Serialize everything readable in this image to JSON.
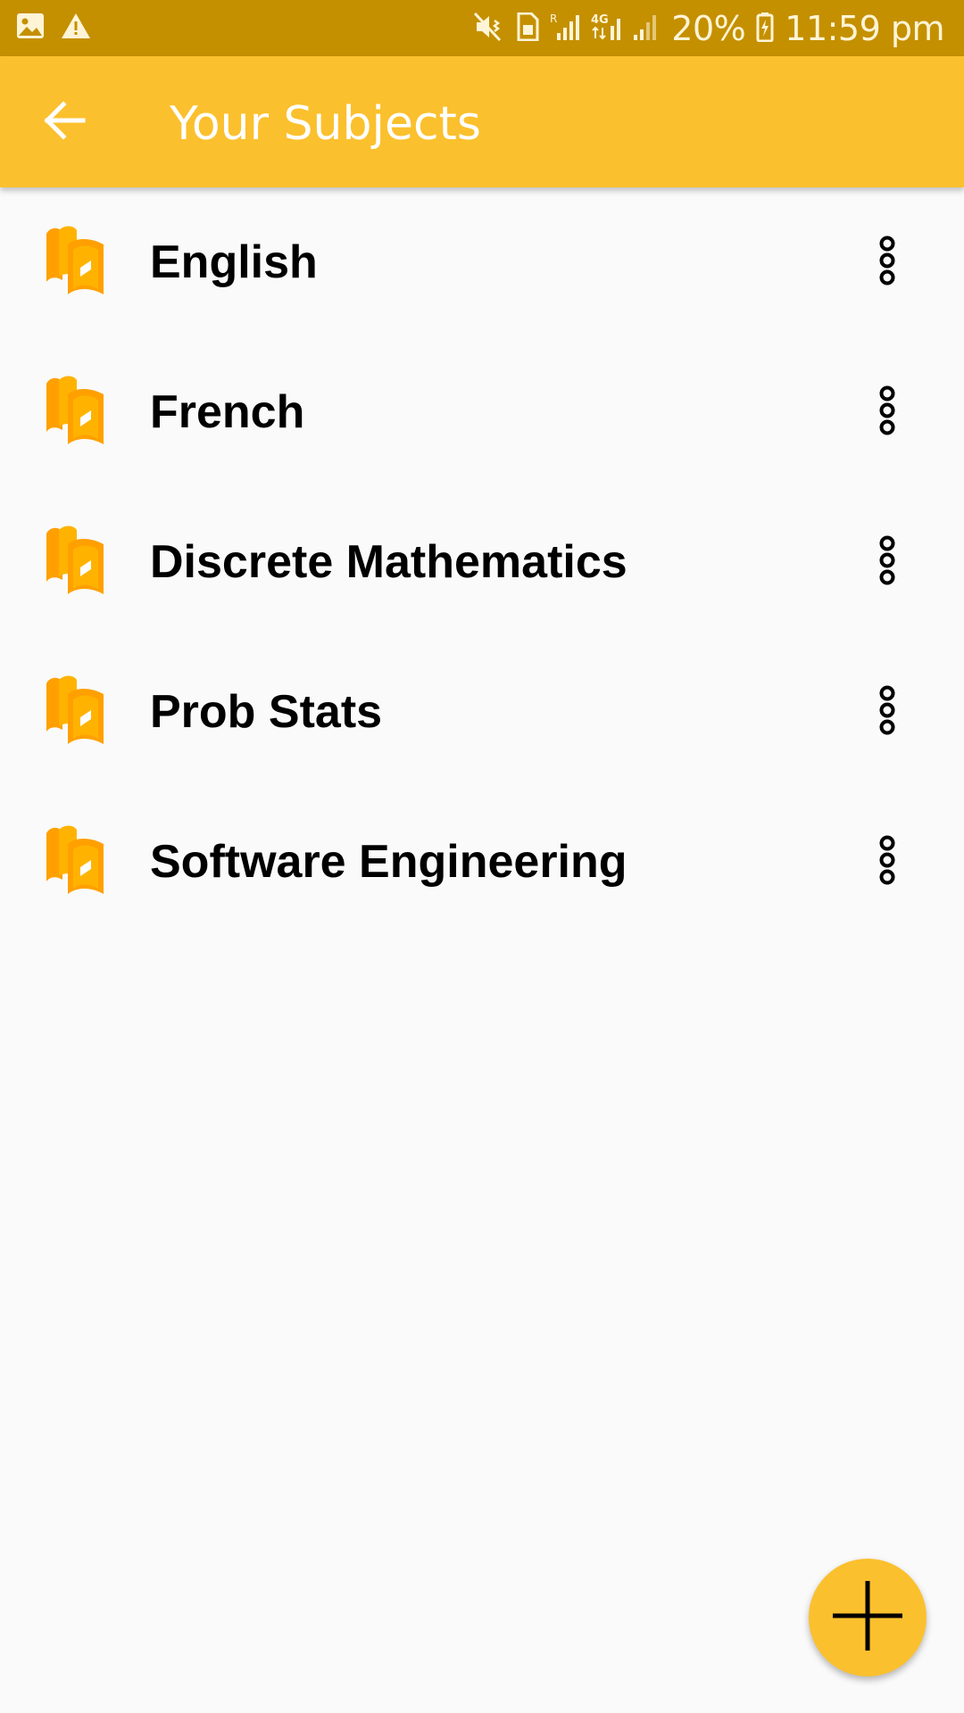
{
  "status_bar": {
    "battery": "20%",
    "time": "11:59 pm",
    "icons": [
      "gallery-icon",
      "warning-icon",
      "mute-vibrate-icon",
      "sim-icon",
      "signal-r-icon",
      "4g-icon",
      "signal-icon",
      "battery-icon"
    ]
  },
  "app_bar": {
    "back_icon": "arrow-back-icon",
    "title": "Your Subjects"
  },
  "subjects": [
    {
      "name": "English",
      "icon": "books-icon",
      "menu_icon": "more-vert-icon"
    },
    {
      "name": "French",
      "icon": "books-icon",
      "menu_icon": "more-vert-icon"
    },
    {
      "name": "Discrete Mathematics",
      "icon": "books-icon",
      "menu_icon": "more-vert-icon"
    },
    {
      "name": "Prob Stats",
      "icon": "books-icon",
      "menu_icon": "more-vert-icon"
    },
    {
      "name": "Software Engineering",
      "icon": "books-icon",
      "menu_icon": "more-vert-icon"
    }
  ],
  "fab": {
    "icon": "add-icon"
  },
  "colors": {
    "status_bar": "#c49000",
    "app_bar": "#fbc02d",
    "background": "#fafafa",
    "icon_accent": "#ffa000",
    "fab": "#fbc02d"
  }
}
